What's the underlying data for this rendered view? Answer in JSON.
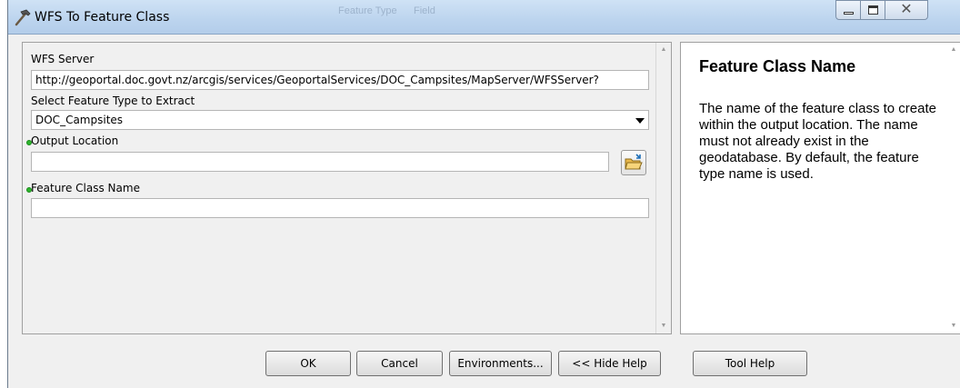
{
  "window": {
    "title": "WFS To Feature Class",
    "ghost_text": [
      "Feature Type",
      "Field"
    ]
  },
  "form": {
    "wfs_server": {
      "label": "WFS Server",
      "value": "http://geoportal.doc.govt.nz/arcgis/services/GeoportalServices/DOC_Campsites/MapServer/WFSServer?"
    },
    "feature_type": {
      "label": "Select Feature Type to Extract",
      "selected": "DOC_Campsites"
    },
    "output_location": {
      "label": "Output Location",
      "value": ""
    },
    "feature_class_name": {
      "label": "Feature Class Name",
      "value": ""
    }
  },
  "help": {
    "title": "Feature Class Name",
    "body": "The name of the feature class to create within the output location. The name must not already exist in the geodatabase. By default, the feature type name is used."
  },
  "buttons": {
    "ok": "OK",
    "cancel": "Cancel",
    "environments": "Environments...",
    "hide_help": "<< Hide Help",
    "tool_help": "Tool Help"
  },
  "colors": {
    "required_dot": "#2db52d",
    "titlebar": "#bcd4ee"
  },
  "icons": {
    "title": "hammer-icon",
    "browse": "folder-open-icon"
  }
}
